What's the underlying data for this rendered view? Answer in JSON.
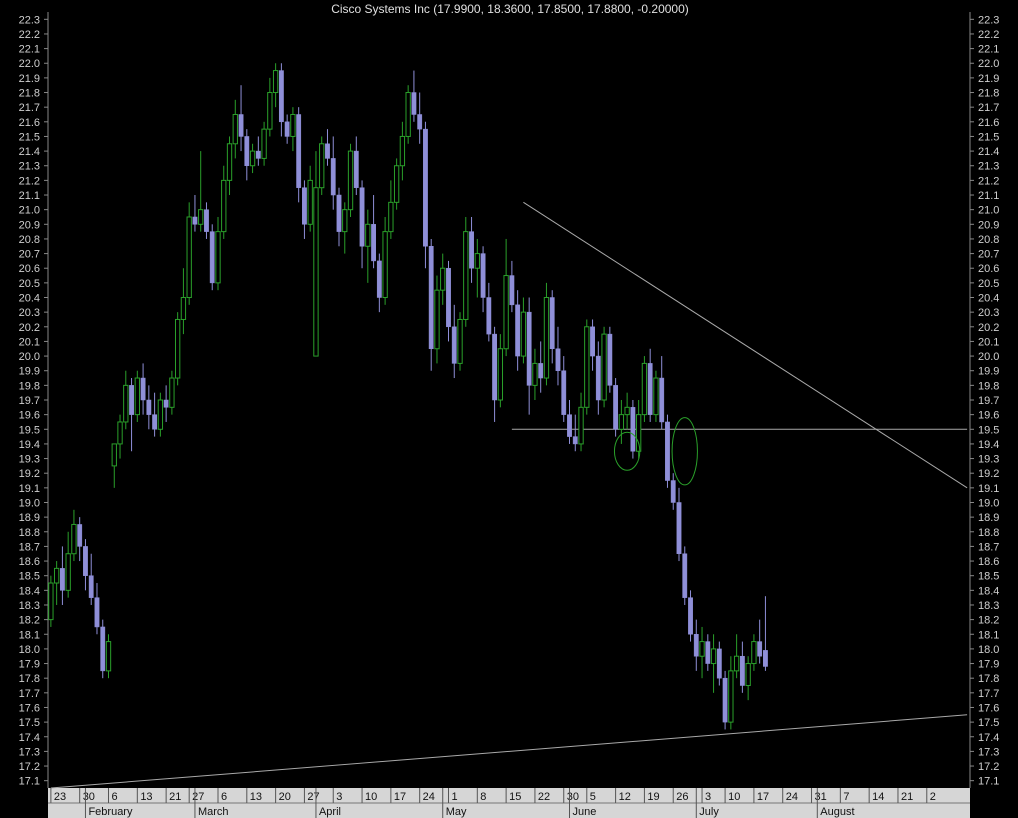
{
  "colors": {
    "background": "#000000",
    "up_candle": "#2aa02a",
    "down_candle": "#8f8fd8",
    "trendline": "#a9a9a9",
    "annotation": "#2aa02a",
    "axis_text": "#cfcfcf",
    "date_axis_bg": "#d6d6d6"
  },
  "chart_data": {
    "type": "candlestick",
    "title": "Cisco Systems Inc (17.9900, 18.3600, 17.8500, 17.8800, -0.20000)",
    "xlabel": "",
    "ylabel": "",
    "y_range": [
      17.05,
      22.35
    ],
    "y_ticks": [
      17.1,
      17.2,
      17.3,
      17.4,
      17.5,
      17.6,
      17.7,
      17.8,
      17.9,
      18.0,
      18.1,
      18.2,
      18.3,
      18.4,
      18.5,
      18.6,
      18.7,
      18.8,
      18.9,
      19.0,
      19.1,
      19.2,
      19.3,
      19.4,
      19.5,
      19.6,
      19.7,
      19.8,
      19.9,
      20.0,
      20.1,
      20.2,
      20.3,
      20.4,
      20.5,
      20.6,
      20.7,
      20.8,
      20.9,
      21.0,
      21.1,
      21.2,
      21.3,
      21.4,
      21.5,
      21.6,
      21.7,
      21.8,
      21.9,
      22.0,
      22.1,
      22.2,
      22.3
    ],
    "y_tick_labels": [
      "17.1",
      "17.2",
      "17.3",
      "17.4",
      "17.5",
      "17.6",
      "17.7",
      "17.8",
      "17.9",
      "18.0",
      "18.1",
      "18.2",
      "18.3",
      "18.4",
      "18.5",
      "18.6",
      "18.7",
      "18.8",
      "18.9",
      "19.0",
      "19.1",
      "19.2",
      "19.3",
      "19.4",
      "19.5",
      "19.6",
      "19.7",
      "19.8",
      "19.9",
      "20.0",
      "20.1",
      "20.2",
      "20.3",
      "20.4",
      "20.5",
      "20.6",
      "20.7",
      "20.8",
      "20.9",
      "21.0",
      "21.1",
      "21.2",
      "21.3",
      "21.4",
      "21.5",
      "21.6",
      "21.7",
      "21.8",
      "21.9",
      "22.0",
      "22.1",
      "22.2",
      "22.3"
    ],
    "x_day_labels": [
      {
        "i": 0,
        "label": "23"
      },
      {
        "i": 5,
        "label": "30"
      },
      {
        "i": 10,
        "label": "6"
      },
      {
        "i": 15,
        "label": "13"
      },
      {
        "i": 20,
        "label": "21"
      },
      {
        "i": 24,
        "label": "27"
      },
      {
        "i": 29,
        "label": "6"
      },
      {
        "i": 34,
        "label": "13"
      },
      {
        "i": 39,
        "label": "20"
      },
      {
        "i": 44,
        "label": "27"
      },
      {
        "i": 49,
        "label": "3"
      },
      {
        "i": 54,
        "label": "10"
      },
      {
        "i": 59,
        "label": "17"
      },
      {
        "i": 64,
        "label": "24"
      },
      {
        "i": 69,
        "label": "1"
      },
      {
        "i": 74,
        "label": "8"
      },
      {
        "i": 79,
        "label": "15"
      },
      {
        "i": 84,
        "label": "22"
      },
      {
        "i": 89,
        "label": "30"
      },
      {
        "i": 93,
        "label": "5"
      },
      {
        "i": 98,
        "label": "12"
      },
      {
        "i": 103,
        "label": "19"
      },
      {
        "i": 108,
        "label": "26"
      },
      {
        "i": 113,
        "label": "3"
      },
      {
        "i": 117,
        "label": "10"
      },
      {
        "i": 122,
        "label": "17"
      },
      {
        "i": 127,
        "label": "24"
      },
      {
        "i": 132,
        "label": "31"
      },
      {
        "i": 137,
        "label": "7"
      },
      {
        "i": 142,
        "label": "14"
      },
      {
        "i": 147,
        "label": "21"
      },
      {
        "i": 152,
        "label": "2"
      }
    ],
    "x_month_labels": [
      {
        "i": 6,
        "label": "February"
      },
      {
        "i": 25,
        "label": "March"
      },
      {
        "i": 46,
        "label": "April"
      },
      {
        "i": 68,
        "label": "May"
      },
      {
        "i": 90,
        "label": "June"
      },
      {
        "i": 112,
        "label": "July"
      },
      {
        "i": 133,
        "label": "August"
      }
    ],
    "candles": [
      [
        18.2,
        18.5,
        18.15,
        18.45
      ],
      [
        18.45,
        18.6,
        18.3,
        18.55
      ],
      [
        18.55,
        18.7,
        18.3,
        18.4
      ],
      [
        18.4,
        18.8,
        18.35,
        18.65
      ],
      [
        18.65,
        18.95,
        18.6,
        18.85
      ],
      [
        18.85,
        18.9,
        18.6,
        18.7
      ],
      [
        18.7,
        18.75,
        18.4,
        18.5
      ],
      [
        18.5,
        18.65,
        18.3,
        18.35
      ],
      [
        18.35,
        18.45,
        18.1,
        18.15
      ],
      [
        18.15,
        18.2,
        17.8,
        17.85
      ],
      [
        17.85,
        18.1,
        17.8,
        18.05
      ],
      [
        19.25,
        19.4,
        19.1,
        19.4
      ],
      [
        19.4,
        19.6,
        19.3,
        19.55
      ],
      [
        19.55,
        19.9,
        19.5,
        19.8
      ],
      [
        19.8,
        19.85,
        19.35,
        19.6
      ],
      [
        19.6,
        19.9,
        19.55,
        19.85
      ],
      [
        19.85,
        19.95,
        19.6,
        19.7
      ],
      [
        19.7,
        19.8,
        19.5,
        19.6
      ],
      [
        19.6,
        19.75,
        19.45,
        19.5
      ],
      [
        19.5,
        19.75,
        19.45,
        19.7
      ],
      [
        19.7,
        19.8,
        19.55,
        19.65
      ],
      [
        19.65,
        19.9,
        19.6,
        19.85
      ],
      [
        19.85,
        20.3,
        19.8,
        20.25
      ],
      [
        20.25,
        20.6,
        20.15,
        20.4
      ],
      [
        20.4,
        21.05,
        20.35,
        20.95
      ],
      [
        20.95,
        21.1,
        20.85,
        20.9
      ],
      [
        20.9,
        21.4,
        20.85,
        21.0
      ],
      [
        21.0,
        21.05,
        20.8,
        20.85
      ],
      [
        20.85,
        20.9,
        20.45,
        20.5
      ],
      [
        20.5,
        20.95,
        20.45,
        20.85
      ],
      [
        20.85,
        21.3,
        20.8,
        21.2
      ],
      [
        21.2,
        21.5,
        21.1,
        21.45
      ],
      [
        21.45,
        21.75,
        21.35,
        21.65
      ],
      [
        21.65,
        21.85,
        21.4,
        21.5
      ],
      [
        21.5,
        21.55,
        21.2,
        21.3
      ],
      [
        21.3,
        21.45,
        21.25,
        21.4
      ],
      [
        21.4,
        21.5,
        21.3,
        21.35
      ],
      [
        21.35,
        21.6,
        21.3,
        21.55
      ],
      [
        21.55,
        21.9,
        21.5,
        21.8
      ],
      [
        21.8,
        22.0,
        21.7,
        21.95
      ],
      [
        21.95,
        22.0,
        21.5,
        21.6
      ],
      [
        21.6,
        21.65,
        21.45,
        21.5
      ],
      [
        21.5,
        21.7,
        21.4,
        21.65
      ],
      [
        21.65,
        21.7,
        21.05,
        21.15
      ],
      [
        21.15,
        21.2,
        20.8,
        20.9
      ],
      [
        20.9,
        21.3,
        20.85,
        21.2
      ],
      [
        20.0,
        21.4,
        20.0,
        21.15
      ],
      [
        21.15,
        21.5,
        21.1,
        21.45
      ],
      [
        21.45,
        21.55,
        21.3,
        21.35
      ],
      [
        21.35,
        21.5,
        21.0,
        21.1
      ],
      [
        21.1,
        21.15,
        20.75,
        20.85
      ],
      [
        20.85,
        21.05,
        20.7,
        21.0
      ],
      [
        21.0,
        21.45,
        20.95,
        21.4
      ],
      [
        21.4,
        21.5,
        21.1,
        21.15
      ],
      [
        21.15,
        21.2,
        20.6,
        20.75
      ],
      [
        20.75,
        21.0,
        20.5,
        20.9
      ],
      [
        20.9,
        21.1,
        20.6,
        20.65
      ],
      [
        20.65,
        20.7,
        20.3,
        20.4
      ],
      [
        20.4,
        20.95,
        20.35,
        20.85
      ],
      [
        20.85,
        21.2,
        20.8,
        21.05
      ],
      [
        21.05,
        21.35,
        21.0,
        21.3
      ],
      [
        21.3,
        21.6,
        21.2,
        21.5
      ],
      [
        21.5,
        21.85,
        21.45,
        21.8
      ],
      [
        21.8,
        21.95,
        21.6,
        21.65
      ],
      [
        21.65,
        21.8,
        21.45,
        21.55
      ],
      [
        21.55,
        21.6,
        20.6,
        20.75
      ],
      [
        20.75,
        20.8,
        19.9,
        20.05
      ],
      [
        20.05,
        20.55,
        19.95,
        20.45
      ],
      [
        20.45,
        20.7,
        20.35,
        20.6
      ],
      [
        20.6,
        20.65,
        20.1,
        20.2
      ],
      [
        20.2,
        20.35,
        19.85,
        19.95
      ],
      [
        19.95,
        20.3,
        19.9,
        20.25
      ],
      [
        20.25,
        20.95,
        20.2,
        20.85
      ],
      [
        20.85,
        20.95,
        20.5,
        20.6
      ],
      [
        20.6,
        20.8,
        20.4,
        20.7
      ],
      [
        20.7,
        20.75,
        20.3,
        20.4
      ],
      [
        20.4,
        20.5,
        20.1,
        20.15
      ],
      [
        20.15,
        20.2,
        19.55,
        19.7
      ],
      [
        19.7,
        20.15,
        19.65,
        20.05
      ],
      [
        20.05,
        20.8,
        20.0,
        20.55
      ],
      [
        20.55,
        20.65,
        20.3,
        20.35
      ],
      [
        20.35,
        20.45,
        19.9,
        20.0
      ],
      [
        20.0,
        20.4,
        19.95,
        20.3
      ],
      [
        20.3,
        20.4,
        19.6,
        19.8
      ],
      [
        19.8,
        20.05,
        19.7,
        19.95
      ],
      [
        19.95,
        20.1,
        19.75,
        19.85
      ],
      [
        19.85,
        20.5,
        19.8,
        20.4
      ],
      [
        20.4,
        20.45,
        19.95,
        20.05
      ],
      [
        20.05,
        20.2,
        19.8,
        19.9
      ],
      [
        19.9,
        20.0,
        19.55,
        19.6
      ],
      [
        19.6,
        19.7,
        19.4,
        19.45
      ],
      [
        19.45,
        19.6,
        19.35,
        19.4
      ],
      [
        19.4,
        19.75,
        19.35,
        19.65
      ],
      [
        19.65,
        20.25,
        19.6,
        20.2
      ],
      [
        20.2,
        20.25,
        19.9,
        20.0
      ],
      [
        20.0,
        20.1,
        19.6,
        19.7
      ],
      [
        19.7,
        20.2,
        19.65,
        20.15
      ],
      [
        20.15,
        20.2,
        19.75,
        19.8
      ],
      [
        19.8,
        19.85,
        19.45,
        19.5
      ],
      [
        19.5,
        19.7,
        19.4,
        19.6
      ],
      [
        19.6,
        19.75,
        19.5,
        19.65
      ],
      [
        19.65,
        19.7,
        19.3,
        19.35
      ],
      [
        19.35,
        19.7,
        19.3,
        19.6
      ],
      [
        19.6,
        20.0,
        19.55,
        19.95
      ],
      [
        19.95,
        20.05,
        19.55,
        19.6
      ],
      [
        19.6,
        19.9,
        19.55,
        19.85
      ],
      [
        19.85,
        20.0,
        19.5,
        19.55
      ],
      [
        19.55,
        19.6,
        19.1,
        19.15
      ],
      [
        19.15,
        19.2,
        18.95,
        19.0
      ],
      [
        19.0,
        19.1,
        18.6,
        18.65
      ],
      [
        18.65,
        18.7,
        18.3,
        18.35
      ],
      [
        18.35,
        18.4,
        18.05,
        18.1
      ],
      [
        18.1,
        18.2,
        17.85,
        17.95
      ],
      [
        17.95,
        18.15,
        17.8,
        18.05
      ],
      [
        18.05,
        18.1,
        17.85,
        17.9
      ],
      [
        17.9,
        18.1,
        17.7,
        18.0
      ],
      [
        18.0,
        18.05,
        17.75,
        17.8
      ],
      [
        17.8,
        17.85,
        17.45,
        17.5
      ],
      [
        17.5,
        17.95,
        17.45,
        17.85
      ],
      [
        17.85,
        18.1,
        17.8,
        17.95
      ],
      [
        17.95,
        18.05,
        17.7,
        17.75
      ],
      [
        17.75,
        17.95,
        17.65,
        17.9
      ],
      [
        17.9,
        18.1,
        17.85,
        18.05
      ],
      [
        18.05,
        18.2,
        17.9,
        17.95
      ],
      [
        17.99,
        18.36,
        17.85,
        17.88
      ]
    ],
    "trendlines": [
      {
        "x0": 0,
        "y0": 17.05,
        "x1": 159,
        "y1": 17.55
      },
      {
        "x0": 82,
        "y0": 21.05,
        "x1": 159,
        "y1": 19.1
      },
      {
        "x0": 80,
        "y0": 19.5,
        "x1": 159,
        "y1": 19.5
      }
    ],
    "annotations": [
      {
        "type": "ellipse",
        "cx": 100,
        "cy": 19.35,
        "rx": 2.2,
        "ry": 0.13
      },
      {
        "type": "ellipse",
        "cx": 110,
        "cy": 19.35,
        "rx": 2.2,
        "ry": 0.23
      }
    ],
    "grid": false,
    "legend": "none"
  }
}
